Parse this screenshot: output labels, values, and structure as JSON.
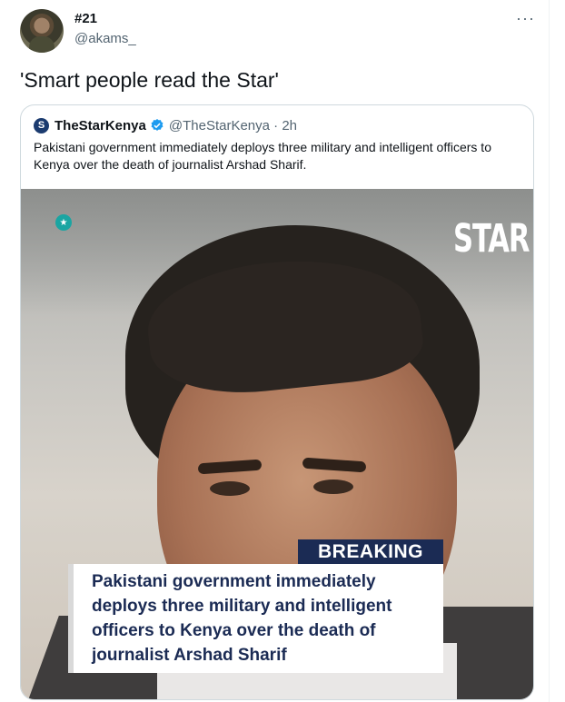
{
  "tweet": {
    "author_name": "#21",
    "author_handle": "@akams_",
    "more_label": "···",
    "text": "'Smart people read the Star'"
  },
  "quoted": {
    "logo_letter": "S",
    "name": "TheStarKenya",
    "meta": "@TheStarKenya · 2h",
    "text": "Pakistani government immediately deploys three military and intelligent officers to Kenya over the death of journalist Arshad Sharif.",
    "media": {
      "brand_logo": "STAR",
      "badge_glyph": "★",
      "breaking_label": "BREAKING",
      "headline": "Pakistani government immediately deploys three military and intelligent officers to Kenya over the death of journalist Arshad Sharif"
    }
  },
  "colors": {
    "verified": "#1d9bf0",
    "headline_navy": "#1b2b54",
    "badge_teal": "#1aa5a2"
  },
  "icons": [
    "more-icon",
    "verified-badge-icon",
    "star-logo-icon"
  ]
}
